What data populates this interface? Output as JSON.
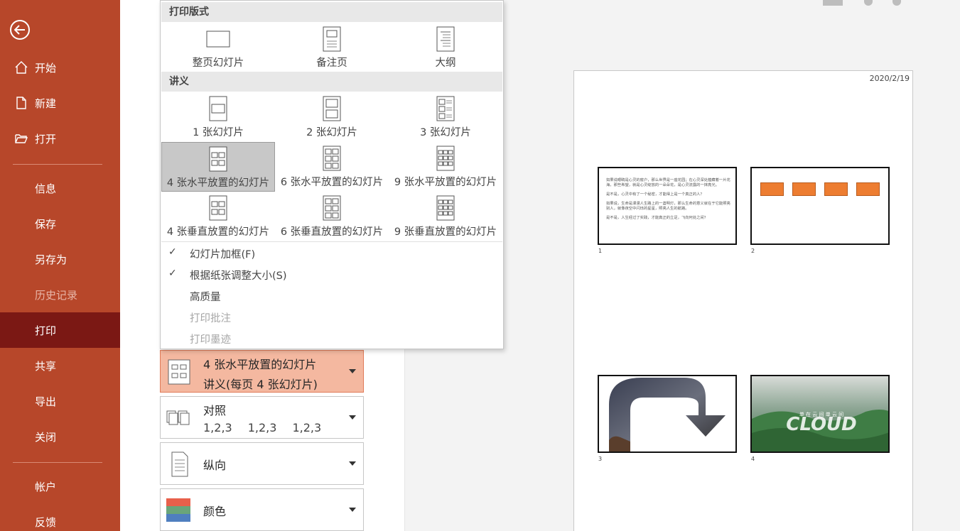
{
  "sidebar": {
    "items": [
      {
        "label": "开始"
      },
      {
        "label": "新建"
      },
      {
        "label": "打开"
      },
      {
        "label": "信息"
      },
      {
        "label": "保存"
      },
      {
        "label": "另存为"
      },
      {
        "label": "历史记录"
      },
      {
        "label": "打印"
      },
      {
        "label": "共享"
      },
      {
        "label": "导出"
      },
      {
        "label": "关闭"
      },
      {
        "label": "帐户"
      },
      {
        "label": "反馈"
      }
    ]
  },
  "colors": {
    "sidebar_bg": "#b7472a",
    "sidebar_active": "#7b1814",
    "selected_setting": "#f4b8a0",
    "accent_orange": "#ed7d31"
  },
  "dropdown": {
    "section1_title": "打印版式",
    "layout_options": [
      {
        "label": "整页幻灯片"
      },
      {
        "label": "备注页"
      },
      {
        "label": "大纲"
      }
    ],
    "section2_title": "讲义",
    "handout_options": [
      {
        "label": "1 张幻灯片"
      },
      {
        "label": "2 张幻灯片"
      },
      {
        "label": "3 张幻灯片"
      },
      {
        "label": "4 张水平放置的幻灯片"
      },
      {
        "label": "6 张水平放置的幻灯片"
      },
      {
        "label": "9 张水平放置的幻灯片"
      },
      {
        "label": "4 张垂直放置的幻灯片"
      },
      {
        "label": "6 张垂直放置的幻灯片"
      },
      {
        "label": "9 张垂直放置的幻灯片"
      }
    ],
    "checkbox_options": [
      {
        "label": "幻灯片加框(F)",
        "check": "✓"
      },
      {
        "label": "根据纸张调整大小(S)",
        "check": "✓"
      },
      {
        "label": "高质量",
        "check": ""
      },
      {
        "label": "打印批注",
        "check": ""
      },
      {
        "label": "打印墨迹",
        "check": ""
      }
    ]
  },
  "settings": {
    "layout": {
      "line1": "4 张水平放置的幻灯片",
      "line2": "讲义(每页 4 张幻灯片)"
    },
    "collate": {
      "line1": "对照",
      "nums": [
        "1,2,3",
        "1,2,3",
        "1,2,3"
      ]
    },
    "orientation": {
      "label": "纵向"
    },
    "color": {
      "label": "颜色"
    }
  },
  "preview": {
    "date": "2020/2/19",
    "slide_numbers": [
      "1",
      "2",
      "3",
      "4"
    ],
    "slide1_paragraphs": [
      "如果说眼睛是心灵的窗户，那么世界是一座花园；在心灵深处蕴藏着一片花海，那些希望，就是心灵绽放的一朵朵花，是心灵流露的一抹亮光。",
      "是不是，心灵中有了一个秘密，才能得上是一个真正的人？",
      "如果说，生命是漫漫人生路上的一盏明灯，那么生命的意义就在于它能照亮别人，就像夜空中闪烁的星星，照亮人生的航路。",
      "是不是，人生经过了实践，才能真正的立足，飞向何处之间？"
    ],
    "slide4_caption": "单 在 云 间 单 云 间",
    "slide4_word": "CLOUD"
  }
}
